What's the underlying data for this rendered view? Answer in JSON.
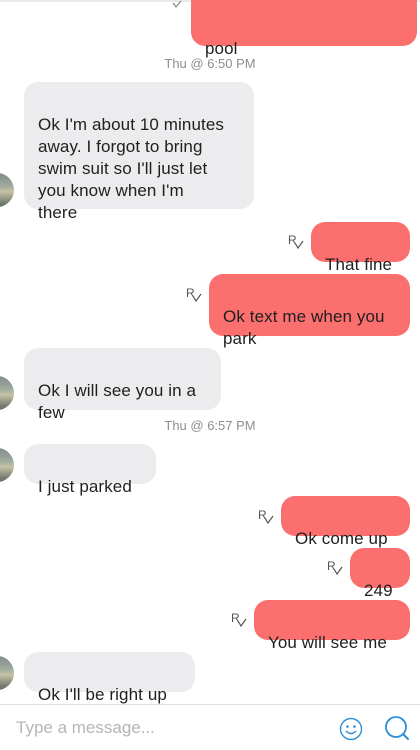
{
  "colors": {
    "sent_bubble": "#fb6f6e",
    "received_bubble": "#ececee",
    "timestamp_text": "#8e8e93",
    "accent": "#2b8fd6"
  },
  "icons": {
    "read_receipt": "read-receipt-icon",
    "delivered": "check-icon",
    "emoji": "emoji-icon",
    "send": "search-icon"
  },
  "conversation": {
    "top_partial_message": "pool",
    "timestamps": [
      "Thu @ 6:50 PM",
      "Thu @ 6:57 PM"
    ],
    "messages": [
      {
        "direction": "received",
        "text": "Ok I'm about 10 minutes\naway.  I forgot to bring\nswim suit so I'll just let\nyou know when I'm\nthere"
      },
      {
        "direction": "sent",
        "text": "That fine",
        "receipt": "R"
      },
      {
        "direction": "sent",
        "text": "Ok text me when you\npark",
        "receipt": "R"
      },
      {
        "direction": "received",
        "text": "Ok I will see you in a\nfew"
      },
      {
        "direction": "received",
        "text": "I just parked"
      },
      {
        "direction": "sent",
        "text": "Ok come up",
        "receipt": "R"
      },
      {
        "direction": "sent",
        "text": "249",
        "receipt": "R"
      },
      {
        "direction": "sent",
        "text": "You will see me",
        "receipt": "R"
      },
      {
        "direction": "received",
        "text": "Ok I'll be right up"
      }
    ]
  },
  "composer": {
    "placeholder": "Type a message..."
  }
}
